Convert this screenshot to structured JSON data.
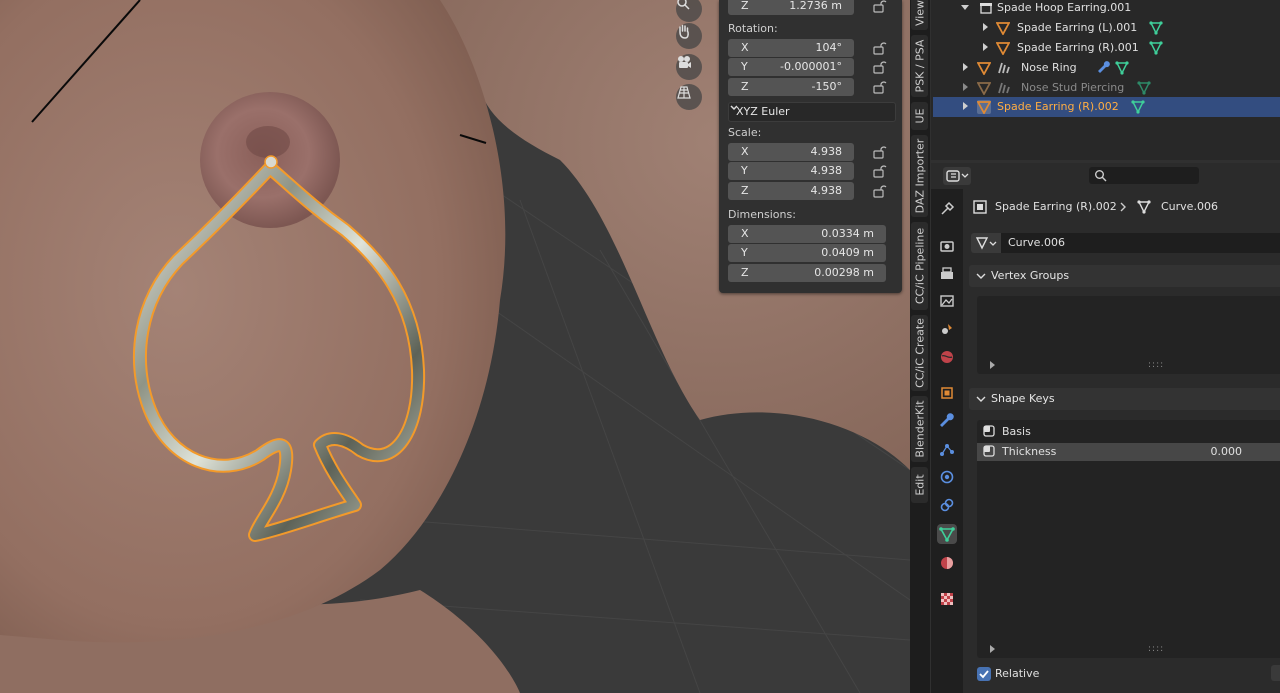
{
  "viewport": {
    "nav_icons": [
      "zoom-icon",
      "hand-pan-icon",
      "camera-icon",
      "grid-perspective-icon"
    ]
  },
  "transform": {
    "location_z": {
      "axis": "Z",
      "value": "1.2736 m"
    },
    "rotation_label": "Rotation:",
    "rotation": [
      {
        "axis": "X",
        "value": "104°"
      },
      {
        "axis": "Y",
        "value": "-0.000001°"
      },
      {
        "axis": "Z",
        "value": "-150°"
      }
    ],
    "rotation_mode": "XYZ Euler",
    "scale_label": "Scale:",
    "scale": [
      {
        "axis": "X",
        "value": "4.938"
      },
      {
        "axis": "Y",
        "value": "4.938"
      },
      {
        "axis": "Z",
        "value": "4.938"
      }
    ],
    "dimensions_label": "Dimensions:",
    "dimensions": [
      {
        "axis": "X",
        "value": "0.0334 m"
      },
      {
        "axis": "Y",
        "value": "0.0409 m"
      },
      {
        "axis": "Z",
        "value": "0.00298 m"
      }
    ]
  },
  "side_tabs": [
    "View",
    "PSK / PSA",
    "UE",
    "DAZ Importer",
    "CC/iC Pipeline",
    "CC/iC Create",
    "BlenderKit",
    "Edit"
  ],
  "outliner": {
    "rows": [
      {
        "label": "Spade Hoop Earring.001"
      },
      {
        "label": "Spade Earring (L).001"
      },
      {
        "label": "Spade Earring (R).001"
      },
      {
        "label": "Nose Ring"
      },
      {
        "label": "Nose Stud Piercing"
      },
      {
        "label": "Spade Earring (R).002"
      }
    ]
  },
  "properties": {
    "search_placeholder": "",
    "breadcrumb_object": "Spade Earring (R).002",
    "breadcrumb_data": "Curve.006",
    "data_name": "Curve.006",
    "vertex_groups_label": "Vertex Groups",
    "shape_keys_label": "Shape Keys",
    "shape_keys": [
      {
        "name": "Basis",
        "value": ""
      },
      {
        "name": "Thickness",
        "value": "0.000"
      }
    ],
    "relative_label": "Relative",
    "relative_checked": true
  },
  "colors": {
    "selection": "#334d80",
    "active_text": "#ffad42",
    "data_icon": "#3fcf9a",
    "object_icon": "#e08a35"
  }
}
